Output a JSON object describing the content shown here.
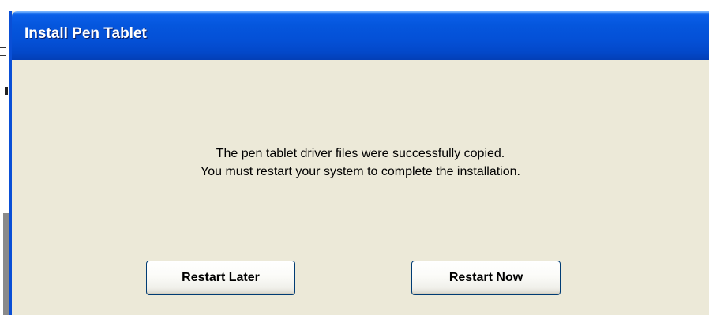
{
  "window": {
    "title": "Install Pen Tablet"
  },
  "message": {
    "line1": "The pen tablet driver files were successfully copied.",
    "line2": "You must restart your system to complete the installation."
  },
  "buttons": {
    "restart_later": "Restart Later",
    "restart_now": "Restart Now"
  },
  "colors": {
    "titlebar": "#0450d6",
    "dialog_background": "#ece9d8",
    "button_border": "#003c74"
  }
}
